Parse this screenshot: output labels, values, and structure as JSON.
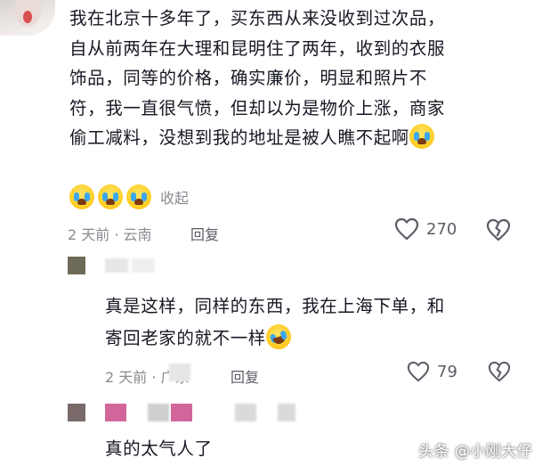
{
  "main_comment": {
    "lines": [
      "我在北京十多年了，买东西从来没收到过次品，",
      "自从前两年在大理和昆明住了两年，收到的衣服",
      "饰品，同等的价格，确实廉价，明显和照片不",
      "符，我一直很气愤，但却以为是物价上涨，商家",
      "偷工减料，没想到我的地址是被人瞧不起啊"
    ],
    "collapse_label": "收起",
    "meta": "2 天前 · 云南",
    "reply_label": "回复",
    "like_count": "270"
  },
  "reply_1": {
    "lines": [
      "真是这样，同样的东西，我在上海下单，和",
      "寄回老家的就不一样"
    ],
    "meta": "2 天前 · 广东",
    "reply_label": "回复",
    "like_count": "79"
  },
  "reply_2": {
    "lines": [
      "真的太气人了"
    ]
  },
  "watermark": "头条 @小刚大仔",
  "colors": {
    "text": "#161823",
    "meta": "#8a8b91",
    "icon": "#5b5d66",
    "pixel_pink": "#d2669a",
    "pixel_dark": "#7a6a6a"
  },
  "icons": {
    "like": "heart-outline-icon",
    "dislike": "broken-heart-icon",
    "emoji_cry": "loudly-crying-face-emoji",
    "emoji_laugh": "rolling-laughing-emoji"
  }
}
